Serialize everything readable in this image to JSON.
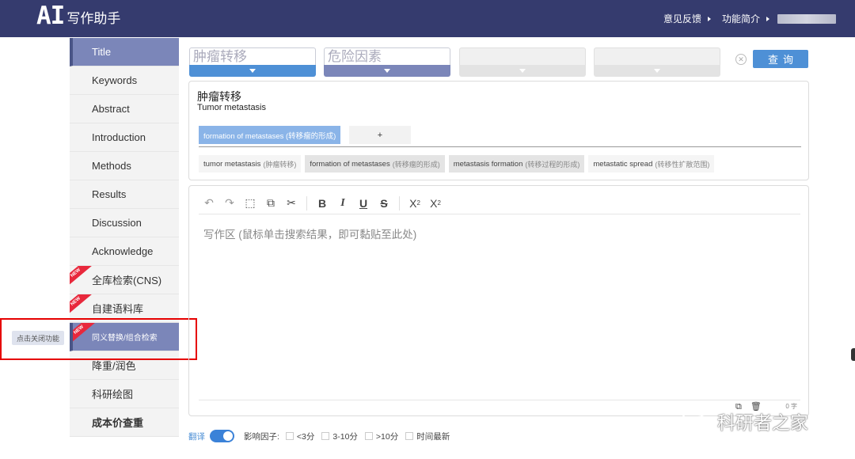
{
  "header": {
    "logo_ai": "AI",
    "logo_text": "写作助手",
    "feedback": "意见反馈",
    "intro": "功能简介"
  },
  "sidebar": {
    "items": [
      {
        "label": "Title",
        "active": true
      },
      {
        "label": "Keywords"
      },
      {
        "label": "Abstract"
      },
      {
        "label": "Introduction"
      },
      {
        "label": "Methods"
      },
      {
        "label": "Results"
      },
      {
        "label": "Discussion"
      },
      {
        "label": "Acknowledge"
      },
      {
        "label": "全库检索(CNS)",
        "badge": "NEW"
      },
      {
        "label": "自建语料库",
        "badge": "NEW"
      },
      {
        "label": "同义替换/组合检索",
        "badge": "NEW",
        "active": true
      },
      {
        "label": "降重/润色"
      },
      {
        "label": "科研绘图"
      },
      {
        "label": "成本价查重",
        "bold": true
      }
    ],
    "close_func_label": "点击关闭功能"
  },
  "search": {
    "box1": "肿瘤转移",
    "box2": "危险因素",
    "box3": "",
    "box4": "",
    "query_label": "查询"
  },
  "term": {
    "cn": "肿瘤转移",
    "en": "Tumor metastasis",
    "selected_chip": "formation of metastases (转移瘤的形成)",
    "add_label": "+",
    "suggestions": [
      {
        "en": "tumor metastasis",
        "cn": "(肿瘤转移)"
      },
      {
        "en": "formation of metastases",
        "cn": "(转移瘤的形成)"
      },
      {
        "en": "metastasis formation",
        "cn": "(转移过程的形成)"
      },
      {
        "en": "metastatic spread",
        "cn": "(转移性扩散范围)"
      }
    ]
  },
  "editor": {
    "placeholder": "写作区 (鼠标单击搜索结果，即可黏贴至此处)",
    "word_count": "0 字"
  },
  "bottom": {
    "translate": "翻译",
    "impact_factor": "影响因子:",
    "filters": [
      "<3分",
      "3-10分",
      ">10分",
      "时间最新"
    ]
  },
  "watermark": "科研者之家",
  "colors": {
    "topbar": "#353b6e",
    "active_sidebar": "#7b86b9",
    "primary": "#4e90d6",
    "highlight_box": "#e60000"
  }
}
